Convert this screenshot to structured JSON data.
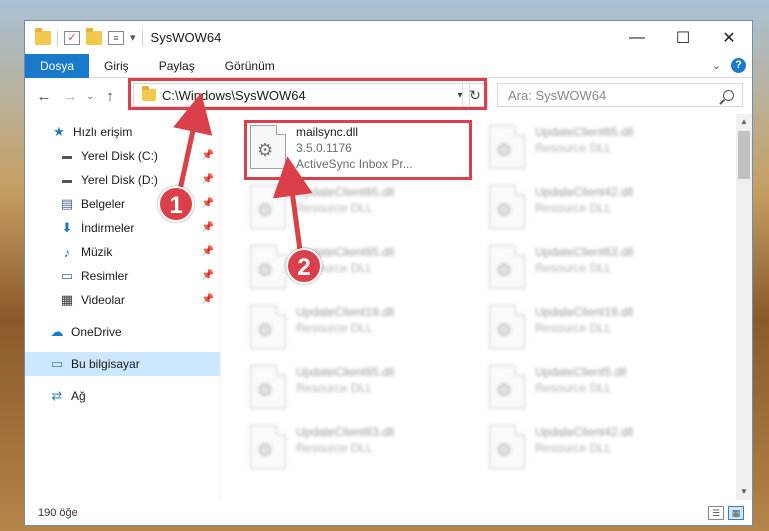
{
  "window": {
    "title": "SysWOW64",
    "minimize_glyph": "—",
    "maximize_glyph": "☐",
    "close_glyph": "✕"
  },
  "ribbon": {
    "tabs": [
      {
        "label": "Dosya",
        "active": true
      },
      {
        "label": "Giriş"
      },
      {
        "label": "Paylaş"
      },
      {
        "label": "Görünüm"
      }
    ],
    "help_label": "?"
  },
  "navigation": {
    "back_glyph": "←",
    "forward_glyph": "→",
    "recent_glyph": "⌄",
    "up_glyph": "↑",
    "address": "C:\\Windows\\SysWOW64",
    "search_placeholder": "Ara: SysWOW64"
  },
  "sidebar": {
    "items": [
      {
        "label": "Hızlı erişim",
        "icon": "star-icon",
        "glyph": "★",
        "pinned": false,
        "indent": false
      },
      {
        "label": "Yerel Disk (C:)",
        "icon": "drive-icon",
        "glyph": "▬",
        "pinned": true,
        "indent": true
      },
      {
        "label": "Yerel Disk (D:)",
        "icon": "drive-icon",
        "glyph": "▬",
        "pinned": true,
        "indent": true
      },
      {
        "label": "Belgeler",
        "icon": "documents-icon",
        "glyph": "▤",
        "pinned": true,
        "indent": true
      },
      {
        "label": "İndirmeler",
        "icon": "download-icon",
        "glyph": "⬇",
        "pinned": true,
        "indent": true
      },
      {
        "label": "Müzik",
        "icon": "music-icon",
        "glyph": "♪",
        "pinned": true,
        "indent": true
      },
      {
        "label": "Resimler",
        "icon": "pictures-icon",
        "glyph": "▭",
        "pinned": true,
        "indent": true
      },
      {
        "label": "Videolar",
        "icon": "videos-icon",
        "glyph": "▦",
        "pinned": true,
        "indent": true
      },
      {
        "label": "OneDrive",
        "icon": "cloud-icon",
        "glyph": "☁",
        "pinned": false,
        "indent": false
      },
      {
        "label": "Bu bilgisayar",
        "icon": "computer-icon",
        "glyph": "▭",
        "pinned": false,
        "indent": false,
        "selected": true
      },
      {
        "label": "Ağ",
        "icon": "network-icon",
        "glyph": "⇄",
        "pinned": false,
        "indent": false
      }
    ]
  },
  "files": {
    "highlighted": {
      "name": "mailsync.dll",
      "version": "3.5.0.1176",
      "description": "ActiveSync Inbox Pr..."
    },
    "blurred_left": [
      {
        "name": "UpdateClient65.dll",
        "description": "Resource DLL"
      },
      {
        "name": "UpdateClient65.dll",
        "description": "Resource DLL"
      },
      {
        "name": "UpdateClient19.dll",
        "description": "Resource DLL"
      },
      {
        "name": "UpdateClient65.dll",
        "description": "Resource DLL"
      },
      {
        "name": "UpdateClient63.dll",
        "description": "Resource DLL"
      }
    ],
    "blurred_right": [
      {
        "name": "UpdateClient65.dll",
        "description": "Resource DLL"
      },
      {
        "name": "UpdateClient42.dll",
        "description": "Resource DLL"
      },
      {
        "name": "UpdateClient63.dll",
        "description": "Resource DLL"
      },
      {
        "name": "UpdateClient19.dll",
        "description": "Resource DLL"
      },
      {
        "name": "UpdateClient5.dll",
        "description": "Resource DLL"
      },
      {
        "name": "UpdateClient42.dll",
        "description": "Resource DLL"
      }
    ]
  },
  "status": {
    "item_count": "190 öğe"
  },
  "annotations": {
    "marker1": "1",
    "marker2": "2"
  },
  "colors": {
    "accent": "#1979ca",
    "highlight": "#d9404a",
    "selected_bg": "#cce8ff"
  }
}
